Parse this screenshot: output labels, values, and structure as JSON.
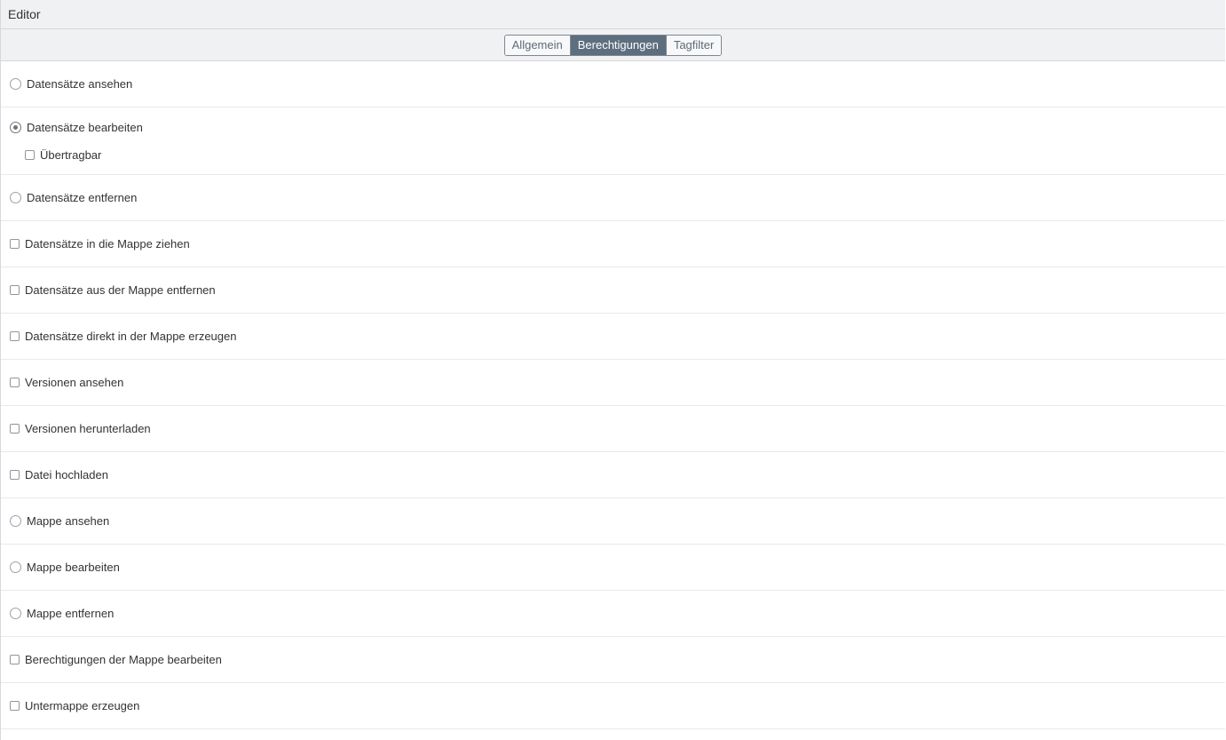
{
  "window": {
    "title": "Editor"
  },
  "tabs": [
    {
      "label": "Allgemein",
      "active": false
    },
    {
      "label": "Berechtigungen",
      "active": true
    },
    {
      "label": "Tagfilter",
      "active": false
    }
  ],
  "permissions": [
    {
      "label": "Datensätze ansehen",
      "control": "radio",
      "checked": false
    },
    {
      "label": "Datensätze bearbeiten",
      "control": "radio",
      "checked": true,
      "sub": {
        "label": "Übertragbar",
        "control": "checkbox",
        "checked": false
      }
    },
    {
      "label": "Datensätze entfernen",
      "control": "radio",
      "checked": false
    },
    {
      "label": "Datensätze in die Mappe ziehen",
      "control": "checkbox",
      "checked": false
    },
    {
      "label": "Datensätze aus der Mappe entfernen",
      "control": "checkbox",
      "checked": false
    },
    {
      "label": "Datensätze direkt in der Mappe erzeugen",
      "control": "checkbox",
      "checked": false
    },
    {
      "label": "Versionen ansehen",
      "control": "checkbox",
      "checked": false
    },
    {
      "label": "Versionen herunterladen",
      "control": "checkbox",
      "checked": false
    },
    {
      "label": "Datei hochladen",
      "control": "checkbox",
      "checked": false
    },
    {
      "label": "Mappe ansehen",
      "control": "radio",
      "checked": false
    },
    {
      "label": "Mappe bearbeiten",
      "control": "radio",
      "checked": false
    },
    {
      "label": "Mappe entfernen",
      "control": "radio",
      "checked": false
    },
    {
      "label": "Berechtigungen der Mappe bearbeiten",
      "control": "checkbox",
      "checked": false
    },
    {
      "label": "Untermappe erzeugen",
      "control": "checkbox",
      "checked": false
    }
  ],
  "colors": {
    "active_tab_bg": "#5d6f7e",
    "header_bg": "#f0f1f3"
  }
}
